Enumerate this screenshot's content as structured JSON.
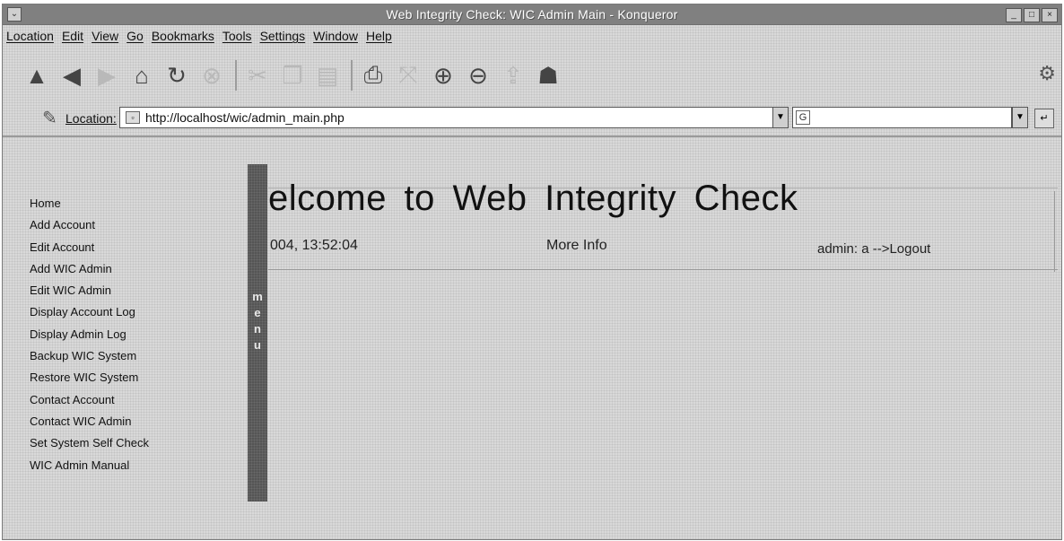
{
  "window": {
    "title": "Web Integrity Check: WIC Admin Main - Konqueror"
  },
  "menubar": {
    "items": [
      "Location",
      "Edit",
      "View",
      "Go",
      "Bookmarks",
      "Tools",
      "Settings",
      "Window",
      "Help"
    ]
  },
  "location": {
    "label": "Location:",
    "url": "http://localhost/wic/admin_main.php",
    "search_engine_glyph": "G"
  },
  "sidebar": {
    "links": [
      "Home",
      "Add Account",
      "Edit Account",
      "Add WIC Admin",
      "Edit WIC Admin",
      "Display Account Log",
      "Display Admin Log",
      "Backup WIC System",
      "Restore WIC System",
      "Contact Account",
      "Contact WIC Admin",
      "Set System Self Check",
      "WIC Admin Manual"
    ],
    "menu_strip_letters": [
      "m",
      "e",
      "n",
      "u"
    ]
  },
  "main": {
    "title": "elcome to Web Integrity Check",
    "datetime": "004, 13:52:04",
    "more_info": "More Info",
    "admin_logout": "admin: a -->Logout"
  },
  "icons": {
    "toolbar": [
      "up-icon",
      "back-icon",
      "forward-icon",
      "home-icon",
      "reload-icon",
      "stop-icon",
      "cut-icon",
      "copy-icon",
      "paste-icon",
      "print-icon",
      "fullscreen-icon",
      "zoom-in-icon",
      "zoom-out-icon",
      "upload-icon",
      "security-icon"
    ]
  }
}
